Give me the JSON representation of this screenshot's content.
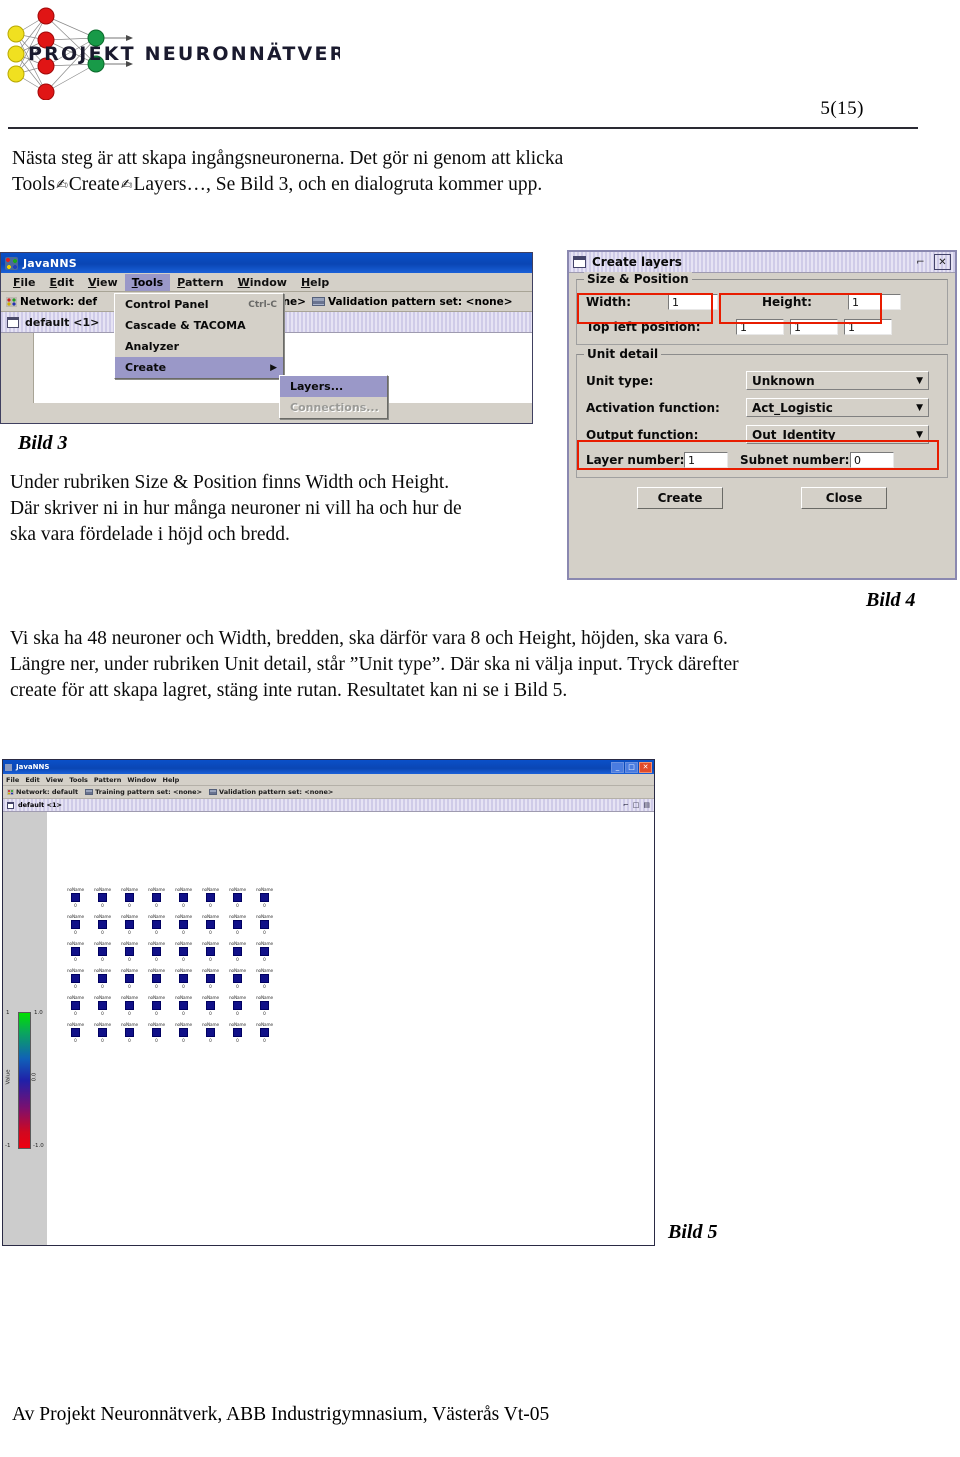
{
  "header": {
    "logo_text": "PROJEKT NEURONNÄTVERK",
    "page_number": "5(15)"
  },
  "body": {
    "intro_line1": "Nästa steg är att skapa ingångsneuronerna. Det gör ni genom att klicka",
    "intro_tools": "Tools",
    "intro_create": "Create",
    "intro_layers": "Layers…, Se Bild 3, och en dialogruta kommer upp.",
    "arrow_glyph": "✍",
    "bild3_label": "Bild 3",
    "bild4_label": "Bild 4",
    "bild5_label": "Bild 5",
    "mid_para_line1": "Under rubriken Size & Position finns Width och Height.",
    "mid_para_line2": "Där skriver ni in hur många neuroner ni vill ha och hur de",
    "mid_para_line3": "ska vara fördelade i höjd och bredd.",
    "after_para_line1": "Vi ska ha 48 neuroner och Width, bredden, ska därför vara 8 och Height, höjden, ska vara 6.",
    "after_para_line2": "Längre ner, under rubriken Unit detail, står ”Unit type”. Där ska ni välja input. Tryck därefter",
    "after_para_line3": "create för att skapa lagret, stäng inte rutan. Resultatet kan ni se i Bild 5.",
    "footer": "Av Projekt Neuronnätverk, ABB Industrigymnasium, Västerås Vt-05"
  },
  "javanns_window": {
    "title": "JavaNNS",
    "menus": [
      {
        "label": "File",
        "first": "F",
        "rest": "ile"
      },
      {
        "label": "Edit",
        "first": "E",
        "rest": "dit"
      },
      {
        "label": "View",
        "first": "V",
        "rest": "iew"
      },
      {
        "label": "Tools",
        "first": "T",
        "rest": "ools"
      },
      {
        "label": "Pattern",
        "first": "P",
        "rest": "attern"
      },
      {
        "label": "Window",
        "first": "W",
        "rest": "indow"
      },
      {
        "label": "Help",
        "first": "H",
        "rest": "elp"
      }
    ],
    "active_menu": "Tools",
    "toolbar": {
      "network_label": "Network: def",
      "training_value": "<none>",
      "validation_label": "Validation pattern set: <none>"
    },
    "subbar_label": "default <1>",
    "dropdown": {
      "items": [
        {
          "label": "Control Panel",
          "accel": "Ctrl-C",
          "selected": false,
          "disabled": false,
          "submenu": false
        },
        {
          "label": "Cascade & TACOMA",
          "accel": "",
          "selected": false,
          "disabled": false,
          "submenu": false
        },
        {
          "label": "Analyzer",
          "accel": "",
          "selected": false,
          "disabled": false,
          "submenu": false
        },
        {
          "label": "Create",
          "accel": "",
          "selected": true,
          "disabled": false,
          "submenu": true
        }
      ],
      "submenu_items": [
        {
          "label": "Layers...",
          "selected": true,
          "disabled": false
        },
        {
          "label": "Connections...",
          "selected": false,
          "disabled": true
        }
      ]
    }
  },
  "create_layers_dialog": {
    "title": "Create layers",
    "titlebar_buttons": [
      "restore-icon",
      "close-icon"
    ],
    "group_size_position": "Size & Position",
    "width_label": "Width:",
    "width_value": "1",
    "height_label": "Height:",
    "height_value": "1",
    "top_left_label": "Top left position:",
    "top_left_values": [
      "1",
      "1",
      "1"
    ],
    "group_unit_detail": "Unit detail",
    "unit_type_label": "Unit type:",
    "unit_type_value": "Unknown",
    "activation_label": "Activation function:",
    "activation_value": "Act_Logistic",
    "output_label": "Output function:",
    "output_value": "Out_Identity",
    "layer_number_label": "Layer number:",
    "layer_number_value": "1",
    "subnet_number_label": "Subnet number:",
    "subnet_number_value": "0",
    "create_button": "Create",
    "close_button": "Close",
    "highlight_color": "#e81c00"
  },
  "bild5_window": {
    "title": "JavaNNS",
    "menus": [
      "File",
      "Edit",
      "View",
      "Tools",
      "Pattern",
      "Window",
      "Help"
    ],
    "toolbar": {
      "network_label": "Network: default",
      "training_label": "Training pattern set: <none>",
      "validation_label": "Validation pattern set: <none>"
    },
    "subbar_label": "default <1>",
    "window_buttons": [
      "minimize-icon",
      "maximize-icon",
      "close-icon"
    ],
    "colorbar": {
      "top_left": "1",
      "top_right": "1.0",
      "mid_left": "Value",
      "mid_right": "0.0",
      "bottom_left": "-1",
      "bottom_right": "-1.0",
      "colors": [
        "#00e000",
        "#2020a8",
        "#ee0010"
      ]
    },
    "neuron_grid": {
      "columns": 8,
      "rows": 6,
      "total": 48,
      "name_label": "noName",
      "value_label": "0",
      "neuron_color": "#101088"
    }
  }
}
